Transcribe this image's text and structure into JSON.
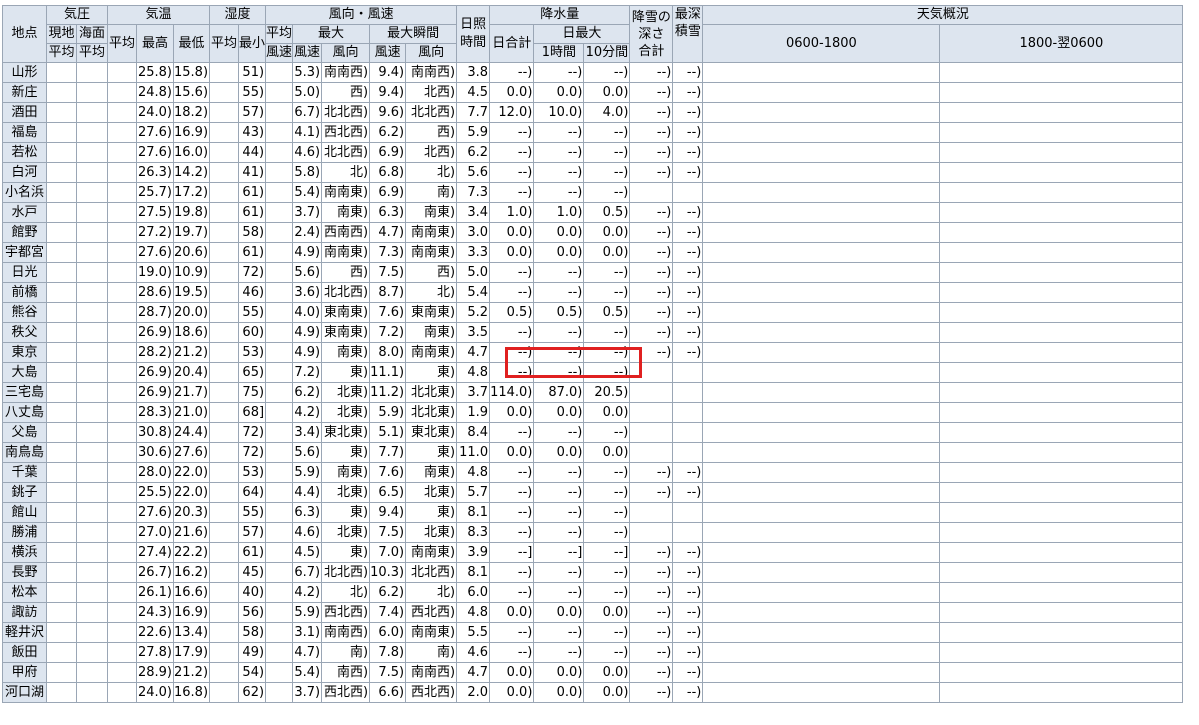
{
  "header": {
    "station": "地点",
    "pressure": "気圧",
    "pressure_ground": "現地",
    "pressure_sea": "海面",
    "avg": "平均",
    "temperature": "気温",
    "max": "最高",
    "min": "最低",
    "humidity": "湿度",
    "min_short": "最小",
    "wind": "風向・風速",
    "avg_line1": "平均",
    "wind_speed": "風速",
    "max_wind": "最大",
    "max_gust": "最大瞬間",
    "wind_dir": "風向",
    "sunshine_l1": "日照",
    "sunshine_l2": "時間",
    "precip": "降水量",
    "precip_total": "日合計",
    "precip_daymax": "日最大",
    "precip_1h": "1時間",
    "precip_10m": "10分間",
    "snowfall_l1": "降雪の",
    "snowfall_l2": "深さ",
    "snowfall_l3": "合計",
    "snowdepth_l1": "最深",
    "snowdepth_l2": "積雪",
    "weather": "天気概況",
    "day": "0600-1800",
    "night": "1800-翌0600"
  },
  "rows": [
    {
      "name": "山形",
      "tmax": "25.8)",
      "tmin": "15.8)",
      "hmin": "51)",
      "wmax": "5.3)",
      "wdir": "南南西)",
      "gust": "9.4)",
      "gdir": "南南西)",
      "sun": "3.8",
      "ptot": "--)",
      "p1h": "--)",
      "p10": "--)",
      "snow": "--)",
      "depth": "--)"
    },
    {
      "name": "新庄",
      "tmax": "24.8)",
      "tmin": "15.6)",
      "hmin": "55)",
      "wmax": "5.0)",
      "wdir": "西)",
      "gust": "9.4)",
      "gdir": "北西)",
      "sun": "4.5",
      "ptot": "0.0)",
      "p1h": "0.0)",
      "p10": "0.0)",
      "snow": "--)",
      "depth": "--)"
    },
    {
      "name": "酒田",
      "tmax": "24.0)",
      "tmin": "18.2)",
      "hmin": "57)",
      "wmax": "6.7)",
      "wdir": "北北西)",
      "gust": "9.6)",
      "gdir": "北北西)",
      "sun": "7.7",
      "ptot": "12.0)",
      "p1h": "10.0)",
      "p10": "4.0)",
      "snow": "--)",
      "depth": "--)"
    },
    {
      "name": "福島",
      "tmax": "27.6)",
      "tmin": "16.9)",
      "hmin": "43)",
      "wmax": "4.1)",
      "wdir": "西北西)",
      "gust": "6.2)",
      "gdir": "西)",
      "sun": "5.9",
      "ptot": "--)",
      "p1h": "--)",
      "p10": "--)",
      "snow": "--)",
      "depth": "--)"
    },
    {
      "name": "若松",
      "tmax": "27.6)",
      "tmin": "16.0)",
      "hmin": "44)",
      "wmax": "4.6)",
      "wdir": "北北西)",
      "gust": "6.9)",
      "gdir": "北西)",
      "sun": "6.2",
      "ptot": "--)",
      "p1h": "--)",
      "p10": "--)",
      "snow": "--)",
      "depth": "--)"
    },
    {
      "name": "白河",
      "tmax": "26.3)",
      "tmin": "14.2)",
      "hmin": "41)",
      "wmax": "5.8)",
      "wdir": "北)",
      "gust": "6.8)",
      "gdir": "北)",
      "sun": "5.6",
      "ptot": "--)",
      "p1h": "--)",
      "p10": "--)",
      "snow": "--)",
      "depth": "--)"
    },
    {
      "name": "小名浜",
      "tmax": "25.7)",
      "tmin": "17.2)",
      "hmin": "61)",
      "wmax": "5.4)",
      "wdir": "南南東)",
      "gust": "6.9)",
      "gdir": "南)",
      "sun": "7.3",
      "ptot": "--)",
      "p1h": "--)",
      "p10": "--)",
      "snow": "",
      "depth": ""
    },
    {
      "name": "水戸",
      "tmax": "27.5)",
      "tmin": "19.8)",
      "hmin": "61)",
      "wmax": "3.7)",
      "wdir": "南東)",
      "gust": "6.3)",
      "gdir": "南東)",
      "sun": "3.4",
      "ptot": "1.0)",
      "p1h": "1.0)",
      "p10": "0.5)",
      "snow": "--)",
      "depth": "--)"
    },
    {
      "name": "館野",
      "tmax": "27.2)",
      "tmin": "19.7)",
      "hmin": "58)",
      "wmax": "2.4)",
      "wdir": "西南西)",
      "gust": "4.7)",
      "gdir": "南南東)",
      "sun": "3.0",
      "ptot": "0.0)",
      "p1h": "0.0)",
      "p10": "0.0)",
      "snow": "--)",
      "depth": "--)"
    },
    {
      "name": "宇都宮",
      "tmax": "27.6)",
      "tmin": "20.6)",
      "hmin": "61)",
      "wmax": "4.9)",
      "wdir": "南南東)",
      "gust": "7.3)",
      "gdir": "南南東)",
      "sun": "3.3",
      "ptot": "0.0)",
      "p1h": "0.0)",
      "p10": "0.0)",
      "snow": "--)",
      "depth": "--)"
    },
    {
      "name": "日光",
      "tmax": "19.0)",
      "tmin": "10.9)",
      "hmin": "72)",
      "wmax": "5.6)",
      "wdir": "西)",
      "gust": "7.5)",
      "gdir": "西)",
      "sun": "5.0",
      "ptot": "--)",
      "p1h": "--)",
      "p10": "--)",
      "snow": "--)",
      "depth": "--)"
    },
    {
      "name": "前橋",
      "tmax": "28.6)",
      "tmin": "19.5)",
      "hmin": "46)",
      "wmax": "3.6)",
      "wdir": "北北西)",
      "gust": "8.7)",
      "gdir": "北)",
      "sun": "5.4",
      "ptot": "--)",
      "p1h": "--)",
      "p10": "--)",
      "snow": "--)",
      "depth": "--)"
    },
    {
      "name": "熊谷",
      "tmax": "28.7)",
      "tmin": "20.0)",
      "hmin": "55)",
      "wmax": "4.0)",
      "wdir": "東南東)",
      "gust": "7.6)",
      "gdir": "東南東)",
      "sun": "5.2",
      "ptot": "0.5)",
      "p1h": "0.5)",
      "p10": "0.5)",
      "snow": "--)",
      "depth": "--)"
    },
    {
      "name": "秩父",
      "tmax": "26.9)",
      "tmin": "18.6)",
      "hmin": "60)",
      "wmax": "4.9)",
      "wdir": "東南東)",
      "gust": "7.2)",
      "gdir": "南東)",
      "sun": "3.5",
      "ptot": "--)",
      "p1h": "--)",
      "p10": "--)",
      "snow": "--)",
      "depth": "--)"
    },
    {
      "name": "東京",
      "tmax": "28.2)",
      "tmin": "21.2)",
      "hmin": "53)",
      "wmax": "4.9)",
      "wdir": "南東)",
      "gust": "8.0)",
      "gdir": "南南東)",
      "sun": "4.7",
      "ptot": "--)",
      "p1h": "--)",
      "p10": "--)",
      "snow": "--)",
      "depth": "--)"
    },
    {
      "name": "大島",
      "tmax": "26.9)",
      "tmin": "20.4)",
      "hmin": "65)",
      "wmax": "7.2)",
      "wdir": "東)",
      "gust": "11.1)",
      "gdir": "東)",
      "sun": "4.8",
      "ptot": "--)",
      "p1h": "--)",
      "p10": "--)",
      "snow": "",
      "depth": ""
    },
    {
      "name": "三宅島",
      "tmax": "26.9)",
      "tmin": "21.7)",
      "hmin": "75)",
      "wmax": "6.2)",
      "wdir": "北東)",
      "gust": "11.2)",
      "gdir": "北北東)",
      "sun": "3.7",
      "ptot": "114.0)",
      "p1h": "87.0)",
      "p10": "20.5)",
      "snow": "",
      "depth": ""
    },
    {
      "name": "八丈島",
      "tmax": "28.3)",
      "tmin": "21.0)",
      "hmin": "68]",
      "wmax": "4.2)",
      "wdir": "北東)",
      "gust": "5.9)",
      "gdir": "北北東)",
      "sun": "1.9",
      "ptot": "0.0)",
      "p1h": "0.0)",
      "p10": "0.0)",
      "snow": "",
      "depth": ""
    },
    {
      "name": "父島",
      "tmax": "30.8)",
      "tmin": "24.4)",
      "hmin": "72)",
      "wmax": "3.4)",
      "wdir": "東北東)",
      "gust": "5.1)",
      "gdir": "東北東)",
      "sun": "8.4",
      "ptot": "--)",
      "p1h": "--)",
      "p10": "--)",
      "snow": "",
      "depth": ""
    },
    {
      "name": "南鳥島",
      "tmax": "30.6)",
      "tmin": "27.6)",
      "hmin": "72)",
      "wmax": "5.6)",
      "wdir": "東)",
      "gust": "7.7)",
      "gdir": "東)",
      "sun": "11.0",
      "ptot": "0.0)",
      "p1h": "0.0)",
      "p10": "0.0)",
      "snow": "",
      "depth": ""
    },
    {
      "name": "千葉",
      "tmax": "28.0)",
      "tmin": "22.0)",
      "hmin": "53)",
      "wmax": "5.9)",
      "wdir": "南東)",
      "gust": "7.6)",
      "gdir": "南東)",
      "sun": "4.8",
      "ptot": "--)",
      "p1h": "--)",
      "p10": "--)",
      "snow": "--)",
      "depth": "--)"
    },
    {
      "name": "銚子",
      "tmax": "25.5)",
      "tmin": "22.0)",
      "hmin": "64)",
      "wmax": "4.4)",
      "wdir": "北東)",
      "gust": "6.5)",
      "gdir": "北東)",
      "sun": "5.7",
      "ptot": "--)",
      "p1h": "--)",
      "p10": "--)",
      "snow": "--)",
      "depth": "--)"
    },
    {
      "name": "館山",
      "tmax": "27.6)",
      "tmin": "20.3)",
      "hmin": "55)",
      "wmax": "6.3)",
      "wdir": "東)",
      "gust": "9.4)",
      "gdir": "東)",
      "sun": "8.1",
      "ptot": "--)",
      "p1h": "--)",
      "p10": "--)",
      "snow": "",
      "depth": ""
    },
    {
      "name": "勝浦",
      "tmax": "27.0)",
      "tmin": "21.6)",
      "hmin": "57)",
      "wmax": "4.6)",
      "wdir": "北東)",
      "gust": "7.5)",
      "gdir": "北東)",
      "sun": "8.3",
      "ptot": "--)",
      "p1h": "--)",
      "p10": "--)",
      "snow": "",
      "depth": ""
    },
    {
      "name": "横浜",
      "tmax": "27.4)",
      "tmin": "22.2)",
      "hmin": "61)",
      "wmax": "4.5)",
      "wdir": "東)",
      "gust": "7.0)",
      "gdir": "南南東)",
      "sun": "3.9",
      "ptot": "--]",
      "p1h": "--]",
      "p10": "--]",
      "snow": "--)",
      "depth": "--)"
    },
    {
      "name": "長野",
      "tmax": "26.7)",
      "tmin": "16.2)",
      "hmin": "45)",
      "wmax": "6.7)",
      "wdir": "北北西)",
      "gust": "10.3)",
      "gdir": "北北西)",
      "sun": "8.1",
      "ptot": "--)",
      "p1h": "--)",
      "p10": "--)",
      "snow": "--)",
      "depth": "--)"
    },
    {
      "name": "松本",
      "tmax": "26.1)",
      "tmin": "16.6)",
      "hmin": "40)",
      "wmax": "4.2)",
      "wdir": "北)",
      "gust": "6.2)",
      "gdir": "北)",
      "sun": "6.0",
      "ptot": "--)",
      "p1h": "--)",
      "p10": "--)",
      "snow": "--)",
      "depth": "--)"
    },
    {
      "name": "諏訪",
      "tmax": "24.3)",
      "tmin": "16.9)",
      "hmin": "56)",
      "wmax": "5.9)",
      "wdir": "西北西)",
      "gust": "7.4)",
      "gdir": "西北西)",
      "sun": "4.8",
      "ptot": "0.0)",
      "p1h": "0.0)",
      "p10": "0.0)",
      "snow": "--)",
      "depth": "--)"
    },
    {
      "name": "軽井沢",
      "tmax": "22.6)",
      "tmin": "13.4)",
      "hmin": "58)",
      "wmax": "3.1)",
      "wdir": "南南西)",
      "gust": "6.0)",
      "gdir": "南南東)",
      "sun": "5.5",
      "ptot": "--)",
      "p1h": "--)",
      "p10": "--)",
      "snow": "--)",
      "depth": "--)"
    },
    {
      "name": "飯田",
      "tmax": "27.8)",
      "tmin": "17.9)",
      "hmin": "49)",
      "wmax": "4.7)",
      "wdir": "南)",
      "gust": "7.8)",
      "gdir": "南)",
      "sun": "4.6",
      "ptot": "--)",
      "p1h": "--)",
      "p10": "--)",
      "snow": "--)",
      "depth": "--)"
    },
    {
      "name": "甲府",
      "tmax": "28.9)",
      "tmin": "21.2)",
      "hmin": "54)",
      "wmax": "5.4)",
      "wdir": "南西)",
      "gust": "7.5)",
      "gdir": "南南西)",
      "sun": "4.7",
      "ptot": "0.0)",
      "p1h": "0.0)",
      "p10": "0.0)",
      "snow": "--)",
      "depth": "--)"
    },
    {
      "name": "河口湖",
      "tmax": "24.0)",
      "tmin": "16.8)",
      "hmin": "62)",
      "wmax": "3.7)",
      "wdir": "西北西)",
      "gust": "6.6)",
      "gdir": "西北西)",
      "sun": "2.0",
      "ptot": "0.0)",
      "p1h": "0.0)",
      "p10": "0.0)",
      "snow": "--)",
      "depth": "--)"
    }
  ]
}
